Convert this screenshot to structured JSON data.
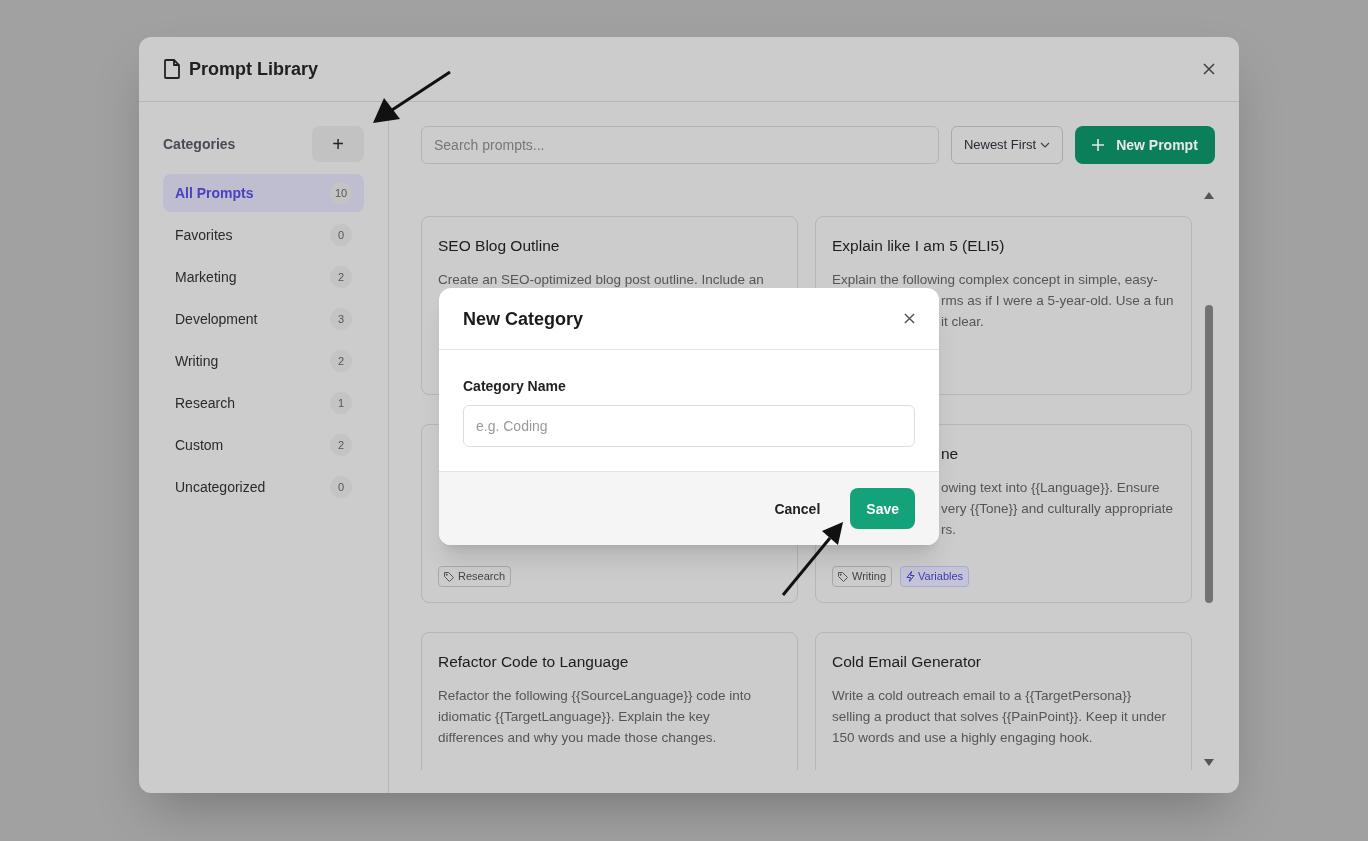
{
  "window": {
    "title": "Prompt Library"
  },
  "sidebar": {
    "heading": "Categories",
    "add_button": "+",
    "items": [
      {
        "label": "All Prompts",
        "count": "10",
        "selected": true
      },
      {
        "label": "Favorites",
        "count": "0",
        "selected": false
      },
      {
        "label": "Marketing",
        "count": "2",
        "selected": false
      },
      {
        "label": "Development",
        "count": "3",
        "selected": false
      },
      {
        "label": "Writing",
        "count": "2",
        "selected": false
      },
      {
        "label": "Research",
        "count": "1",
        "selected": false
      },
      {
        "label": "Custom",
        "count": "2",
        "selected": false
      },
      {
        "label": "Uncategorized",
        "count": "0",
        "selected": false
      }
    ]
  },
  "toolbar": {
    "search": {
      "placeholder": "Search prompts..."
    },
    "sort": "Newest First",
    "new_button": "New Prompt"
  },
  "cards": [
    {
      "title": "SEO Blog Outline",
      "description_fragments": [
        {
          "text": "Create an SEO-optimized blog post outline. Include an",
          "partial": false
        }
      ]
    },
    {
      "title": "Explain like I am 5 (ELI5)",
      "description_fragments": [
        {
          "text": "Explain the following complex concept in simple, easy-",
          "partial": false
        },
        {
          "text": "rms as if I were a 5-year-old. Use a fun",
          "partial": true
        },
        {
          "text": "it clear.",
          "partial": true
        }
      ]
    },
    {
      "tags": [
        {
          "label": "Research",
          "kind": "category"
        }
      ]
    },
    {
      "title_fragment": "ne",
      "description_fragments": [
        {
          "text": "owing text into {{Language}}. Ensure",
          "partial": true
        },
        {
          "text": "very {{Tone}} and culturally appropriate",
          "partial": true
        },
        {
          "text": "rs.",
          "partial": true
        }
      ],
      "tags": [
        {
          "label": "Writing",
          "kind": "category"
        },
        {
          "label": "Variables",
          "kind": "variables"
        }
      ]
    },
    {
      "title": "Refactor Code to Language",
      "description": "Refactor the following {{SourceLanguage}} code into idiomatic {{TargetLanguage}}. Explain the key differences and why you made those changes."
    },
    {
      "title": "Cold Email Generator",
      "description": "Write a cold outreach email to a {{TargetPersona}} selling a product that solves {{PainPoint}}. Keep it under 150 words and use a highly engaging hook."
    }
  ],
  "dialog": {
    "title": "New Category",
    "field_label": "Category Name",
    "placeholder": "e.g. Coding",
    "buttons": [
      "Cancel",
      "Save"
    ]
  }
}
